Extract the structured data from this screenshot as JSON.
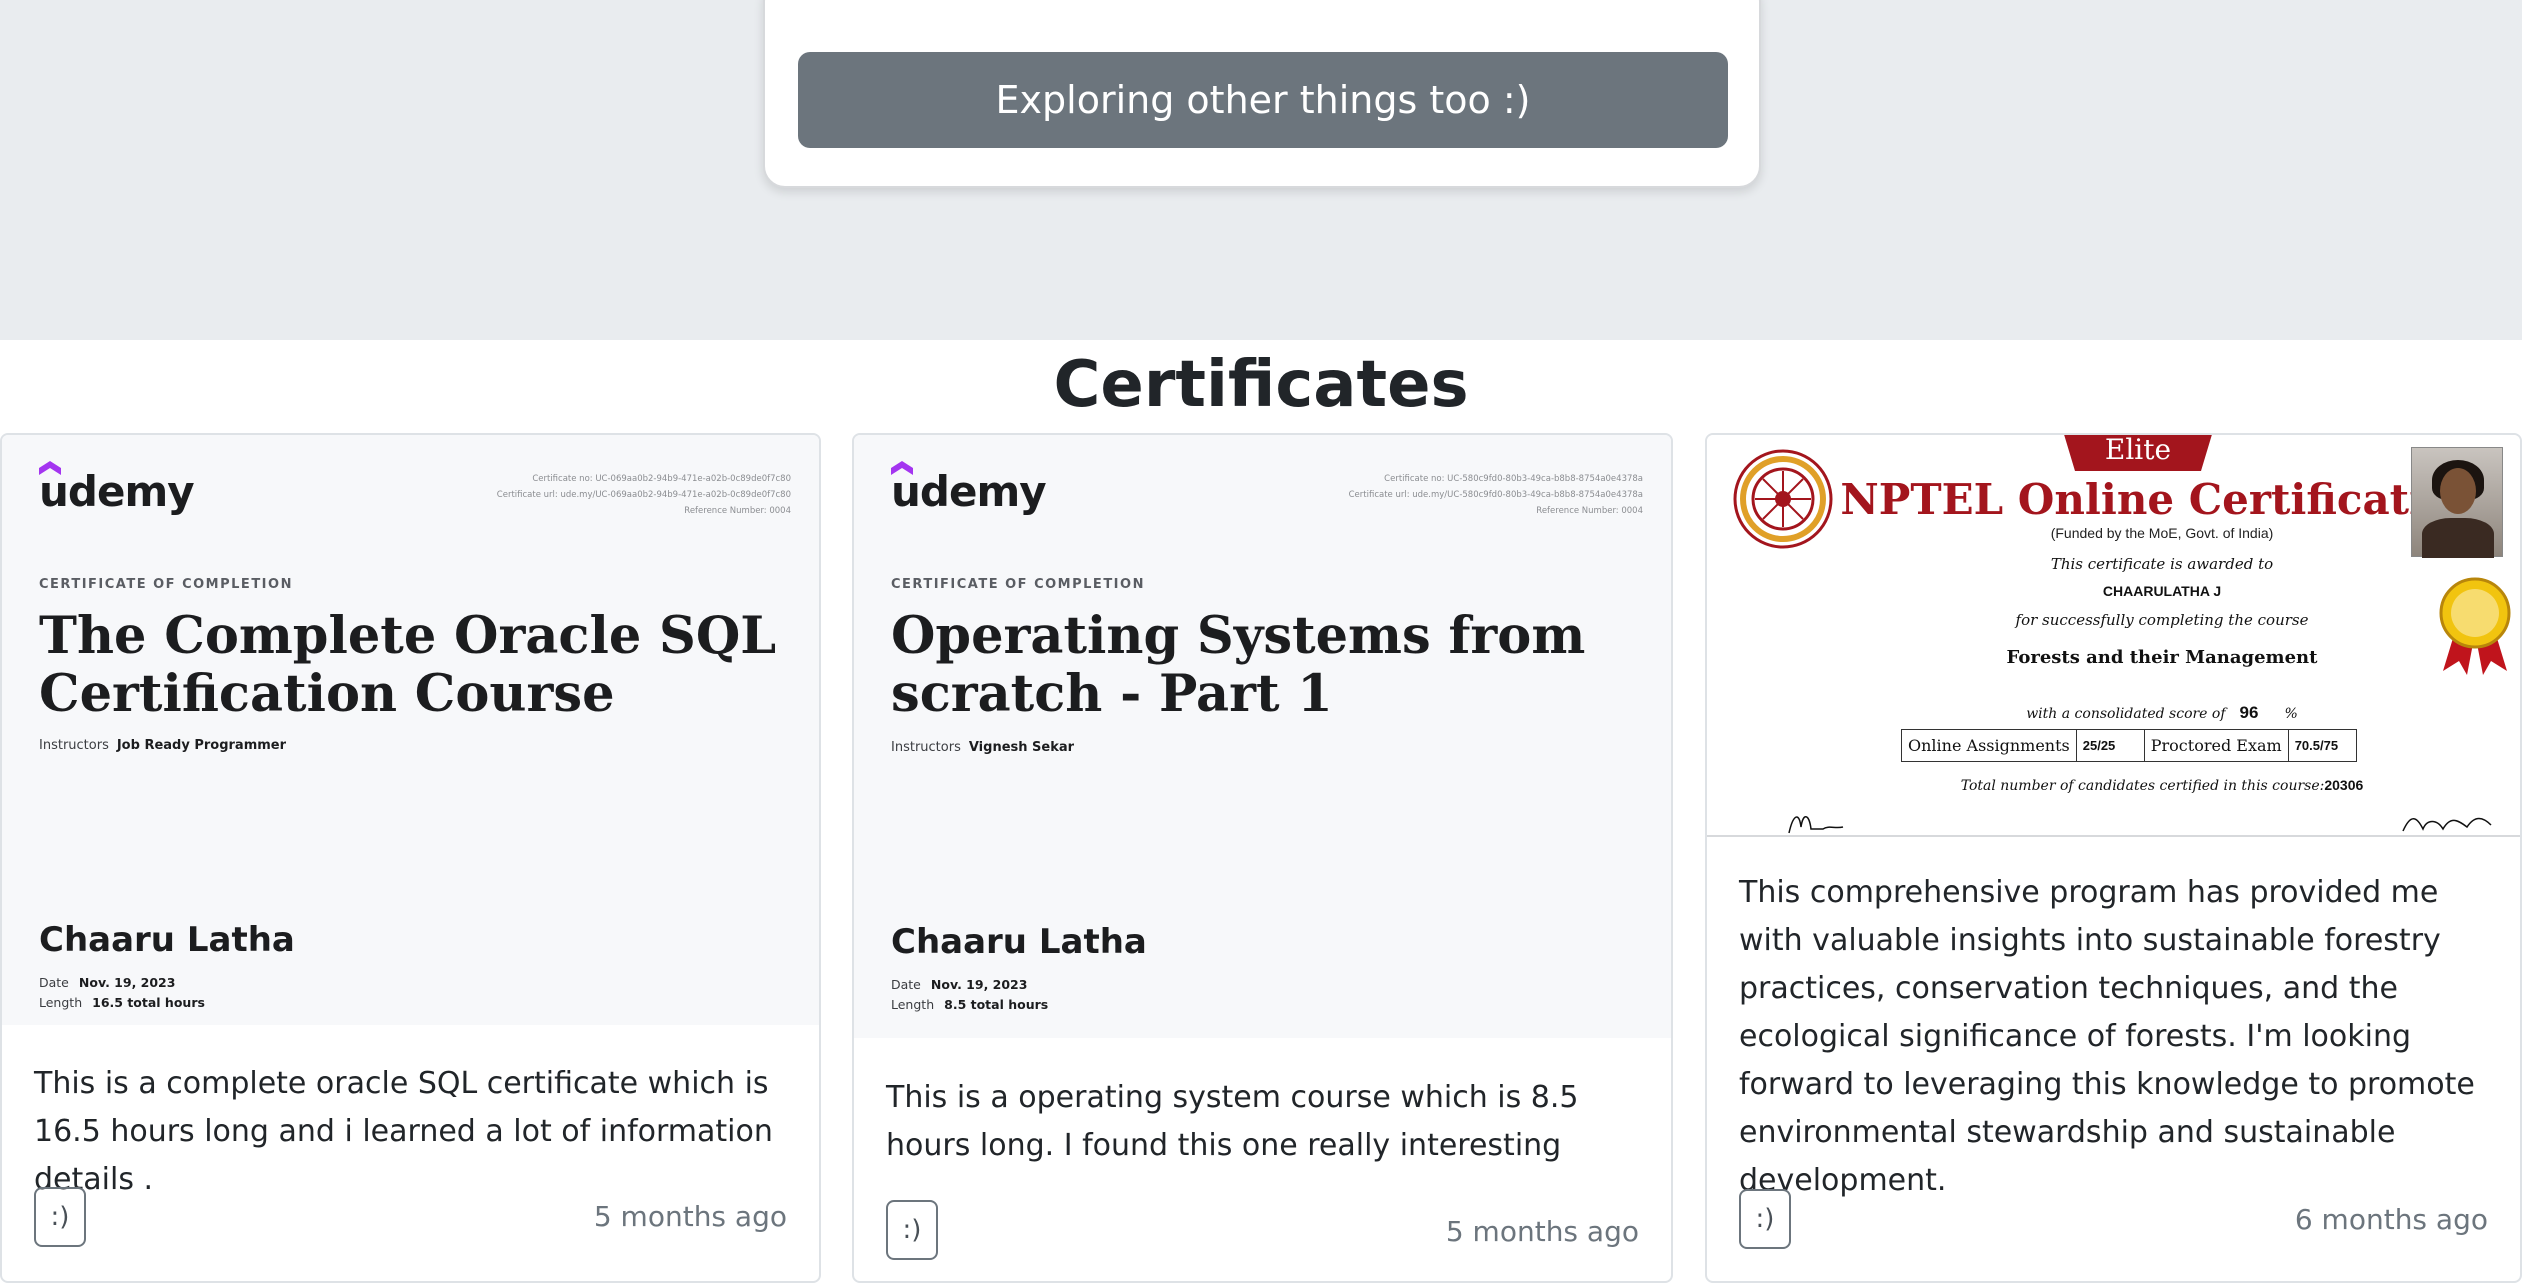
{
  "top": {
    "explore_button": "Exploring other things too :)"
  },
  "section_title": "Certificates",
  "colors": {
    "band": "#e9ecef",
    "button_gray": "#6c757d",
    "nptel_red": "#a3151d"
  },
  "cards": [
    {
      "certificate": {
        "logo": "udemy",
        "cert_no": "Certificate no: UC-069aa0b2-94b9-471e-a02b-0c89de0f7c80",
        "cert_url": "Certificate url: ude.my/UC-069aa0b2-94b9-471e-a02b-0c89de0f7c80",
        "ref": "Reference Number: 0004",
        "label": "CERTIFICATE OF COMPLETION",
        "title": "The Complete Oracle SQL Certification Course",
        "instructors_label": "Instructors",
        "instructor": "Job Ready Programmer",
        "student": "Chaaru Latha",
        "date_label": "Date",
        "date": "Nov. 19, 2023",
        "length_label": "Length",
        "length": "16.5 total hours"
      },
      "text": "This is a complete oracle SQL certificate which is 16.5 hours long and i learned a lot of information details .",
      "button": ":)",
      "time": "5 months ago"
    },
    {
      "certificate": {
        "logo": "udemy",
        "cert_no": "Certificate no: UC-580c9fd0-80b3-49ca-b8b8-8754a0e4378a",
        "cert_url": "Certificate url: ude.my/UC-580c9fd0-80b3-49ca-b8b8-8754a0e4378a",
        "ref": "Reference Number: 0004",
        "label": "CERTIFICATE OF COMPLETION",
        "title": "Operating Systems from scratch - Part 1",
        "instructors_label": "Instructors",
        "instructor": "Vignesh Sekar",
        "student": "Chaaru Latha",
        "date_label": "Date",
        "date": "Nov. 19, 2023",
        "length_label": "Length",
        "length": "8.5 total hours"
      },
      "text": "This is a operating system course which is 8.5 hours long. I found this one really interesting",
      "button": ":)",
      "time": "5 months ago"
    },
    {
      "certificate": {
        "badge": "Elite",
        "title": "NPTEL Online Certification",
        "funded": "(Funded by the MoE, Govt. of India)",
        "awarded": "This certificate is awarded to",
        "name": "CHAARULATHA J",
        "success": "for successfully completing the course",
        "course": "Forests and their Management",
        "score_label": "with a consolidated score of",
        "score": "96",
        "percent": "%",
        "assign_label": "Online Assignments",
        "assign_val": "25/25",
        "exam_label": "Proctored Exam",
        "exam_val": "70.5/75",
        "total_label": "Total number of candidates certified in this course:",
        "total": "20306"
      },
      "text": "This comprehensive program has provided me with valuable insights into sustainable forestry practices, conservation techniques, and the ecological significance of forests. I'm looking forward to leveraging this knowledge to promote environmental stewardship and sustainable development.",
      "button": ":)",
      "time": "6 months ago"
    }
  ]
}
